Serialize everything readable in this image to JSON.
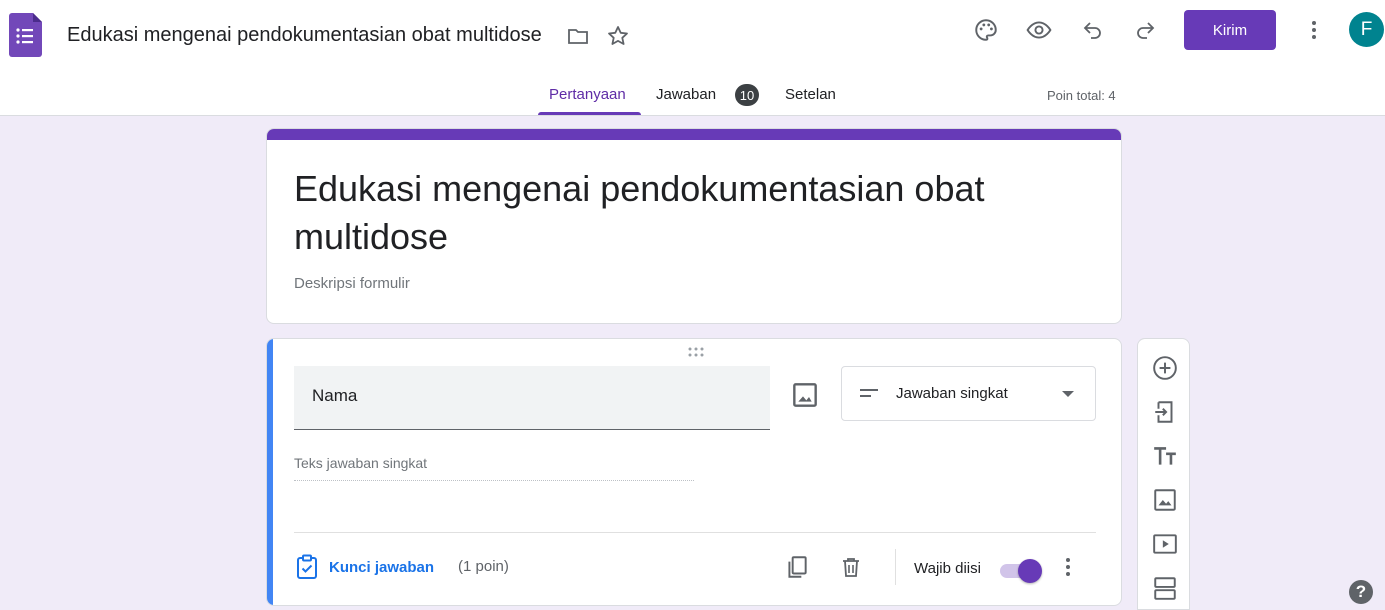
{
  "header": {
    "doc_title": "Edukasi mengenai pendokumentasian obat multidose",
    "send_label": "Kirim",
    "avatar_initial": "F",
    "icons": [
      "forms-logo-icon",
      "folder-icon",
      "star-icon",
      "palette-icon",
      "preview-eye-icon",
      "undo-icon",
      "redo-icon",
      "more-vert-icon"
    ],
    "accent_color": "#673ab7"
  },
  "tabs": {
    "questions": "Pertanyaan",
    "responses": "Jawaban",
    "responses_count": "10",
    "settings": "Setelan",
    "active": "Pertanyaan"
  },
  "points_total": "Poin total: 4",
  "form": {
    "title": "Edukasi mengenai pendokumentasian obat multidose",
    "description_placeholder": "Deskripsi formulir"
  },
  "question": {
    "title": "Nama",
    "type": "Jawaban singkat",
    "answer_placeholder": "Teks jawaban singkat",
    "answer_key_label": "Kunci jawaban",
    "points": "(1 poin)",
    "required_label": "Wajib diisi",
    "required": true
  },
  "side_toolbar": [
    "add-question-icon",
    "import-questions-icon",
    "add-title-icon",
    "add-image-icon",
    "add-video-icon",
    "add-section-icon"
  ],
  "help": "?"
}
